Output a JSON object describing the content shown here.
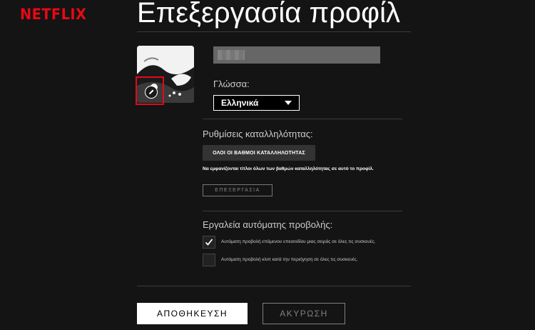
{
  "brand": {
    "logo_text": "NETFLIX",
    "color": "#e50914"
  },
  "page": {
    "title": "Επεξεργασία προφίλ"
  },
  "profile": {
    "avatar_icon": "profile-avatar-image",
    "edit_icon": "pencil-icon",
    "name_value": ""
  },
  "language": {
    "label": "Γλώσσα:",
    "selected": "Ελληνικά"
  },
  "maturity": {
    "label": "Ρυθμίσεις καταλληλότητας:",
    "badge": "ΟΛΟΙ ΟΙ ΒΑΘΜΟΙ ΚΑΤΑΛΛΗΛΟΤΗΤΑΣ",
    "description": "Να εμφανίζονται τίτλοι όλων των βαθμών καταλληλότητας σε αυτό το προφίλ.",
    "edit_label": "ΕΠΕΞΕΡΓΑΣΙΑ"
  },
  "autoplay": {
    "label": "Εργαλεία αυτόματης προβολής:",
    "options": [
      {
        "text": "Αυτόματη προβολή επόμενου επεισοδίου μιας σειράς σε όλες τις συσκευές.",
        "checked": true
      },
      {
        "text": "Αυτόματη προβολή κλιπ κατά την περιήγηση σε όλες τις συσκευές.",
        "checked": false
      }
    ]
  },
  "actions": {
    "save_label": "ΑΠΟΘΗΚΕΥΣΗ",
    "cancel_label": "ΑΚΥΡΩΣΗ"
  }
}
